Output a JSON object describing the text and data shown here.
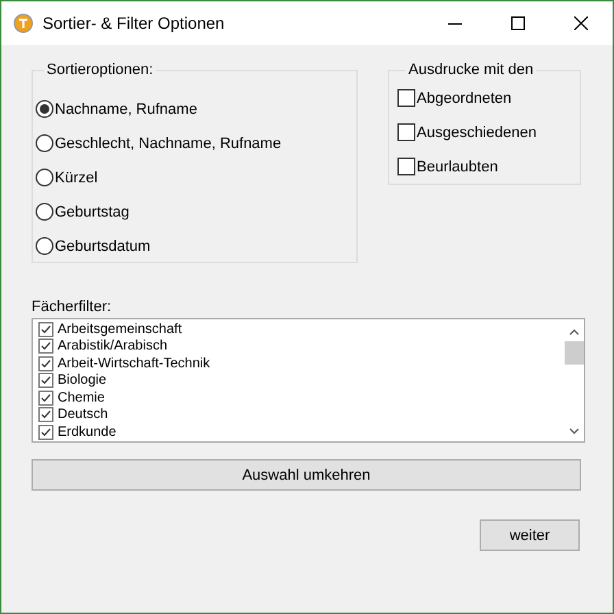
{
  "window": {
    "title": "Sortier- & Filter Optionen"
  },
  "sort_options": {
    "label": "Sortieroptionen:",
    "options": [
      {
        "label": "Nachname, Rufname",
        "selected": true
      },
      {
        "label": "Geschlecht, Nachname, Rufname",
        "selected": false
      },
      {
        "label": "Kürzel",
        "selected": false
      },
      {
        "label": "Geburtstag",
        "selected": false
      },
      {
        "label": "Geburtsdatum",
        "selected": false
      }
    ]
  },
  "print_options": {
    "label": "Ausdrucke mit den",
    "options": [
      {
        "label": "Abgeordneten",
        "checked": false
      },
      {
        "label": "Ausgeschiedenen",
        "checked": false
      },
      {
        "label": "Beurlaubten",
        "checked": false
      }
    ]
  },
  "subject_filter": {
    "label": "Fächerfilter:",
    "items": [
      {
        "label": "Arbeitsgemeinschaft",
        "checked": true
      },
      {
        "label": "Arabistik/Arabisch",
        "checked": true
      },
      {
        "label": "Arbeit-Wirtschaft-Technik",
        "checked": true
      },
      {
        "label": "Biologie",
        "checked": true
      },
      {
        "label": "Chemie",
        "checked": true
      },
      {
        "label": "Deutsch",
        "checked": true
      },
      {
        "label": "Erdkunde",
        "checked": true
      }
    ]
  },
  "buttons": [
    {
      "label": "Auswahl umkehren",
      "kind": "wide"
    },
    {
      "label": "weiter",
      "kind": "small"
    }
  ]
}
